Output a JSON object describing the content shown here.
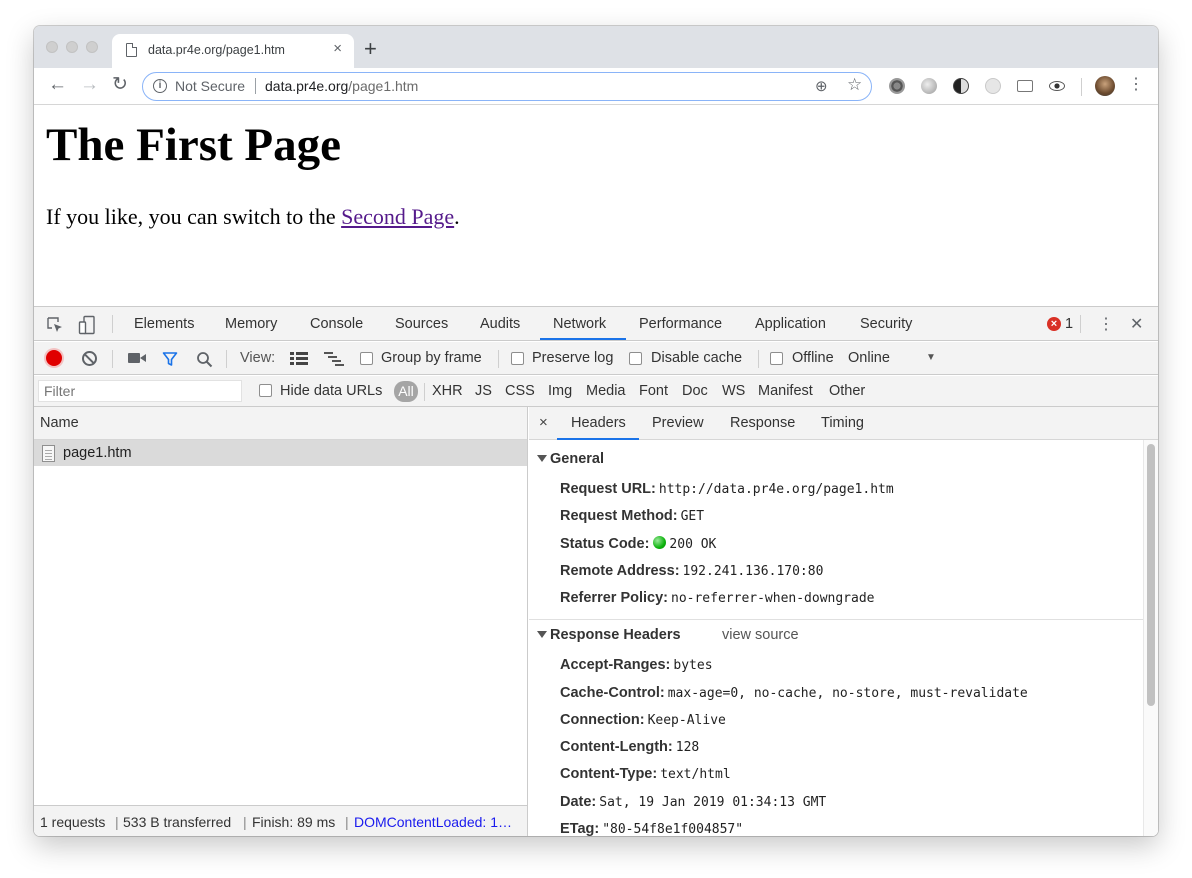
{
  "browser": {
    "tab_title": "data.pr4e.org/page1.htm",
    "tab_close": "×",
    "new_tab": "+",
    "back": "←",
    "forward": "→",
    "reload": "↻",
    "security_label": "Not Secure",
    "url_host": "data.pr4e.org",
    "url_path": "/page1.htm",
    "zoom_icon": "⊕",
    "star_icon": "☆",
    "menu": "⋮"
  },
  "page": {
    "heading": "The First Page",
    "para_before": "If you like, you can switch to the ",
    "link_text": "Second Page",
    "para_after": "."
  },
  "devtools": {
    "tabs": [
      "Elements",
      "Memory",
      "Console",
      "Sources",
      "Audits",
      "Network",
      "Performance",
      "Application",
      "Security"
    ],
    "active_tab": "Network",
    "error_count": "1",
    "close": "✕",
    "menu": "⋮",
    "toolbar": {
      "view_label": "View:",
      "group_by_frame": "Group by frame",
      "preserve_log": "Preserve log",
      "disable_cache": "Disable cache",
      "offline": "Offline",
      "throttle": "Online",
      "dropdown_arrow": "▼"
    },
    "filter": {
      "placeholder": "Filter",
      "hide_data_urls": "Hide data URLs",
      "types": [
        "All",
        "XHR",
        "JS",
        "CSS",
        "Img",
        "Media",
        "Font",
        "Doc",
        "WS",
        "Manifest",
        "Other"
      ]
    },
    "requests": {
      "column_header": "Name",
      "rows": [
        "page1.htm"
      ]
    },
    "status_bar": {
      "requests": "1 requests",
      "transferred": "533 B transferred",
      "finish": "Finish: 89 ms",
      "dcl": "DOMContentLoaded: 1…",
      "separator": "|"
    },
    "detail": {
      "close": "×",
      "tabs": [
        "Headers",
        "Preview",
        "Response",
        "Timing"
      ],
      "active_tab": "Headers",
      "general_title": "General",
      "general": [
        {
          "key": "Request URL:",
          "value": "http://data.pr4e.org/page1.htm"
        },
        {
          "key": "Request Method:",
          "value": "GET"
        },
        {
          "key": "Status Code:",
          "value": "200 OK"
        },
        {
          "key": "Remote Address:",
          "value": "192.241.136.170:80"
        },
        {
          "key": "Referrer Policy:",
          "value": "no-referrer-when-downgrade"
        }
      ],
      "response_title": "Response Headers",
      "view_source": "view source",
      "response": [
        {
          "key": "Accept-Ranges:",
          "value": "bytes"
        },
        {
          "key": "Cache-Control:",
          "value": "max-age=0, no-cache, no-store, must-revalidate"
        },
        {
          "key": "Connection:",
          "value": "Keep-Alive"
        },
        {
          "key": "Content-Length:",
          "value": "128"
        },
        {
          "key": "Content-Type:",
          "value": "text/html"
        },
        {
          "key": "Date:",
          "value": "Sat, 19 Jan 2019 01:34:13 GMT"
        },
        {
          "key": "ETag:",
          "value": "\"80-54f8e1f004857\""
        }
      ]
    }
  },
  "colors": {
    "accent": "#1a73e8",
    "record": "#e00000",
    "link": "#551a8b",
    "status_ok": "#0db30d",
    "error": "#d93025"
  }
}
